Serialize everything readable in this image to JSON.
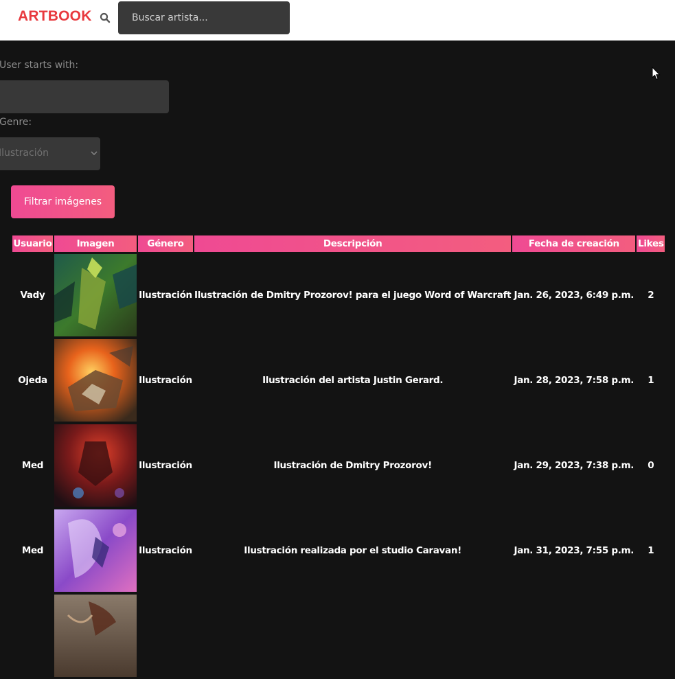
{
  "brand": "ARTBOOK",
  "search": {
    "placeholder": "Buscar artista..."
  },
  "filters": {
    "user_label": "User starts with:",
    "user_value": "",
    "genre_label": "Genre:",
    "genre_selected": "Ilustración",
    "submit_label": "Filtrar imágenes"
  },
  "table": {
    "headers": [
      "Usuario",
      "Imagen",
      "Género",
      "Descripción",
      "Fecha de creación",
      "Likes"
    ],
    "rows": [
      {
        "usuario": "Vady",
        "genero": "Ilustración",
        "descripcion": "Ilustración de Dmitry Prozorov! para el juego Word of Warcraft",
        "fecha": "Jan. 26, 2023, 6:49 p.m.",
        "likes": "2"
      },
      {
        "usuario": "Ojeda",
        "genero": "Ilustración",
        "descripcion": "Ilustración del artista Justin Gerard.",
        "fecha": "Jan. 28, 2023, 7:58 p.m.",
        "likes": "1"
      },
      {
        "usuario": "Med",
        "genero": "Ilustración",
        "descripcion": "Ilustración de Dmitry Prozorov!",
        "fecha": "Jan. 29, 2023, 7:38 p.m.",
        "likes": "0"
      },
      {
        "usuario": "Med",
        "genero": "Ilustración",
        "descripcion": "Ilustración realizada por el studio Caravan!",
        "fecha": "Jan. 31, 2023, 7:55 p.m.",
        "likes": "1"
      },
      {
        "usuario": "",
        "genero": "",
        "descripcion": "",
        "fecha": "",
        "likes": ""
      }
    ]
  },
  "colors": {
    "brand": "#e8393e",
    "accent_start": "#ef4a93",
    "accent_end": "#f35d7f",
    "background": "#131313"
  }
}
